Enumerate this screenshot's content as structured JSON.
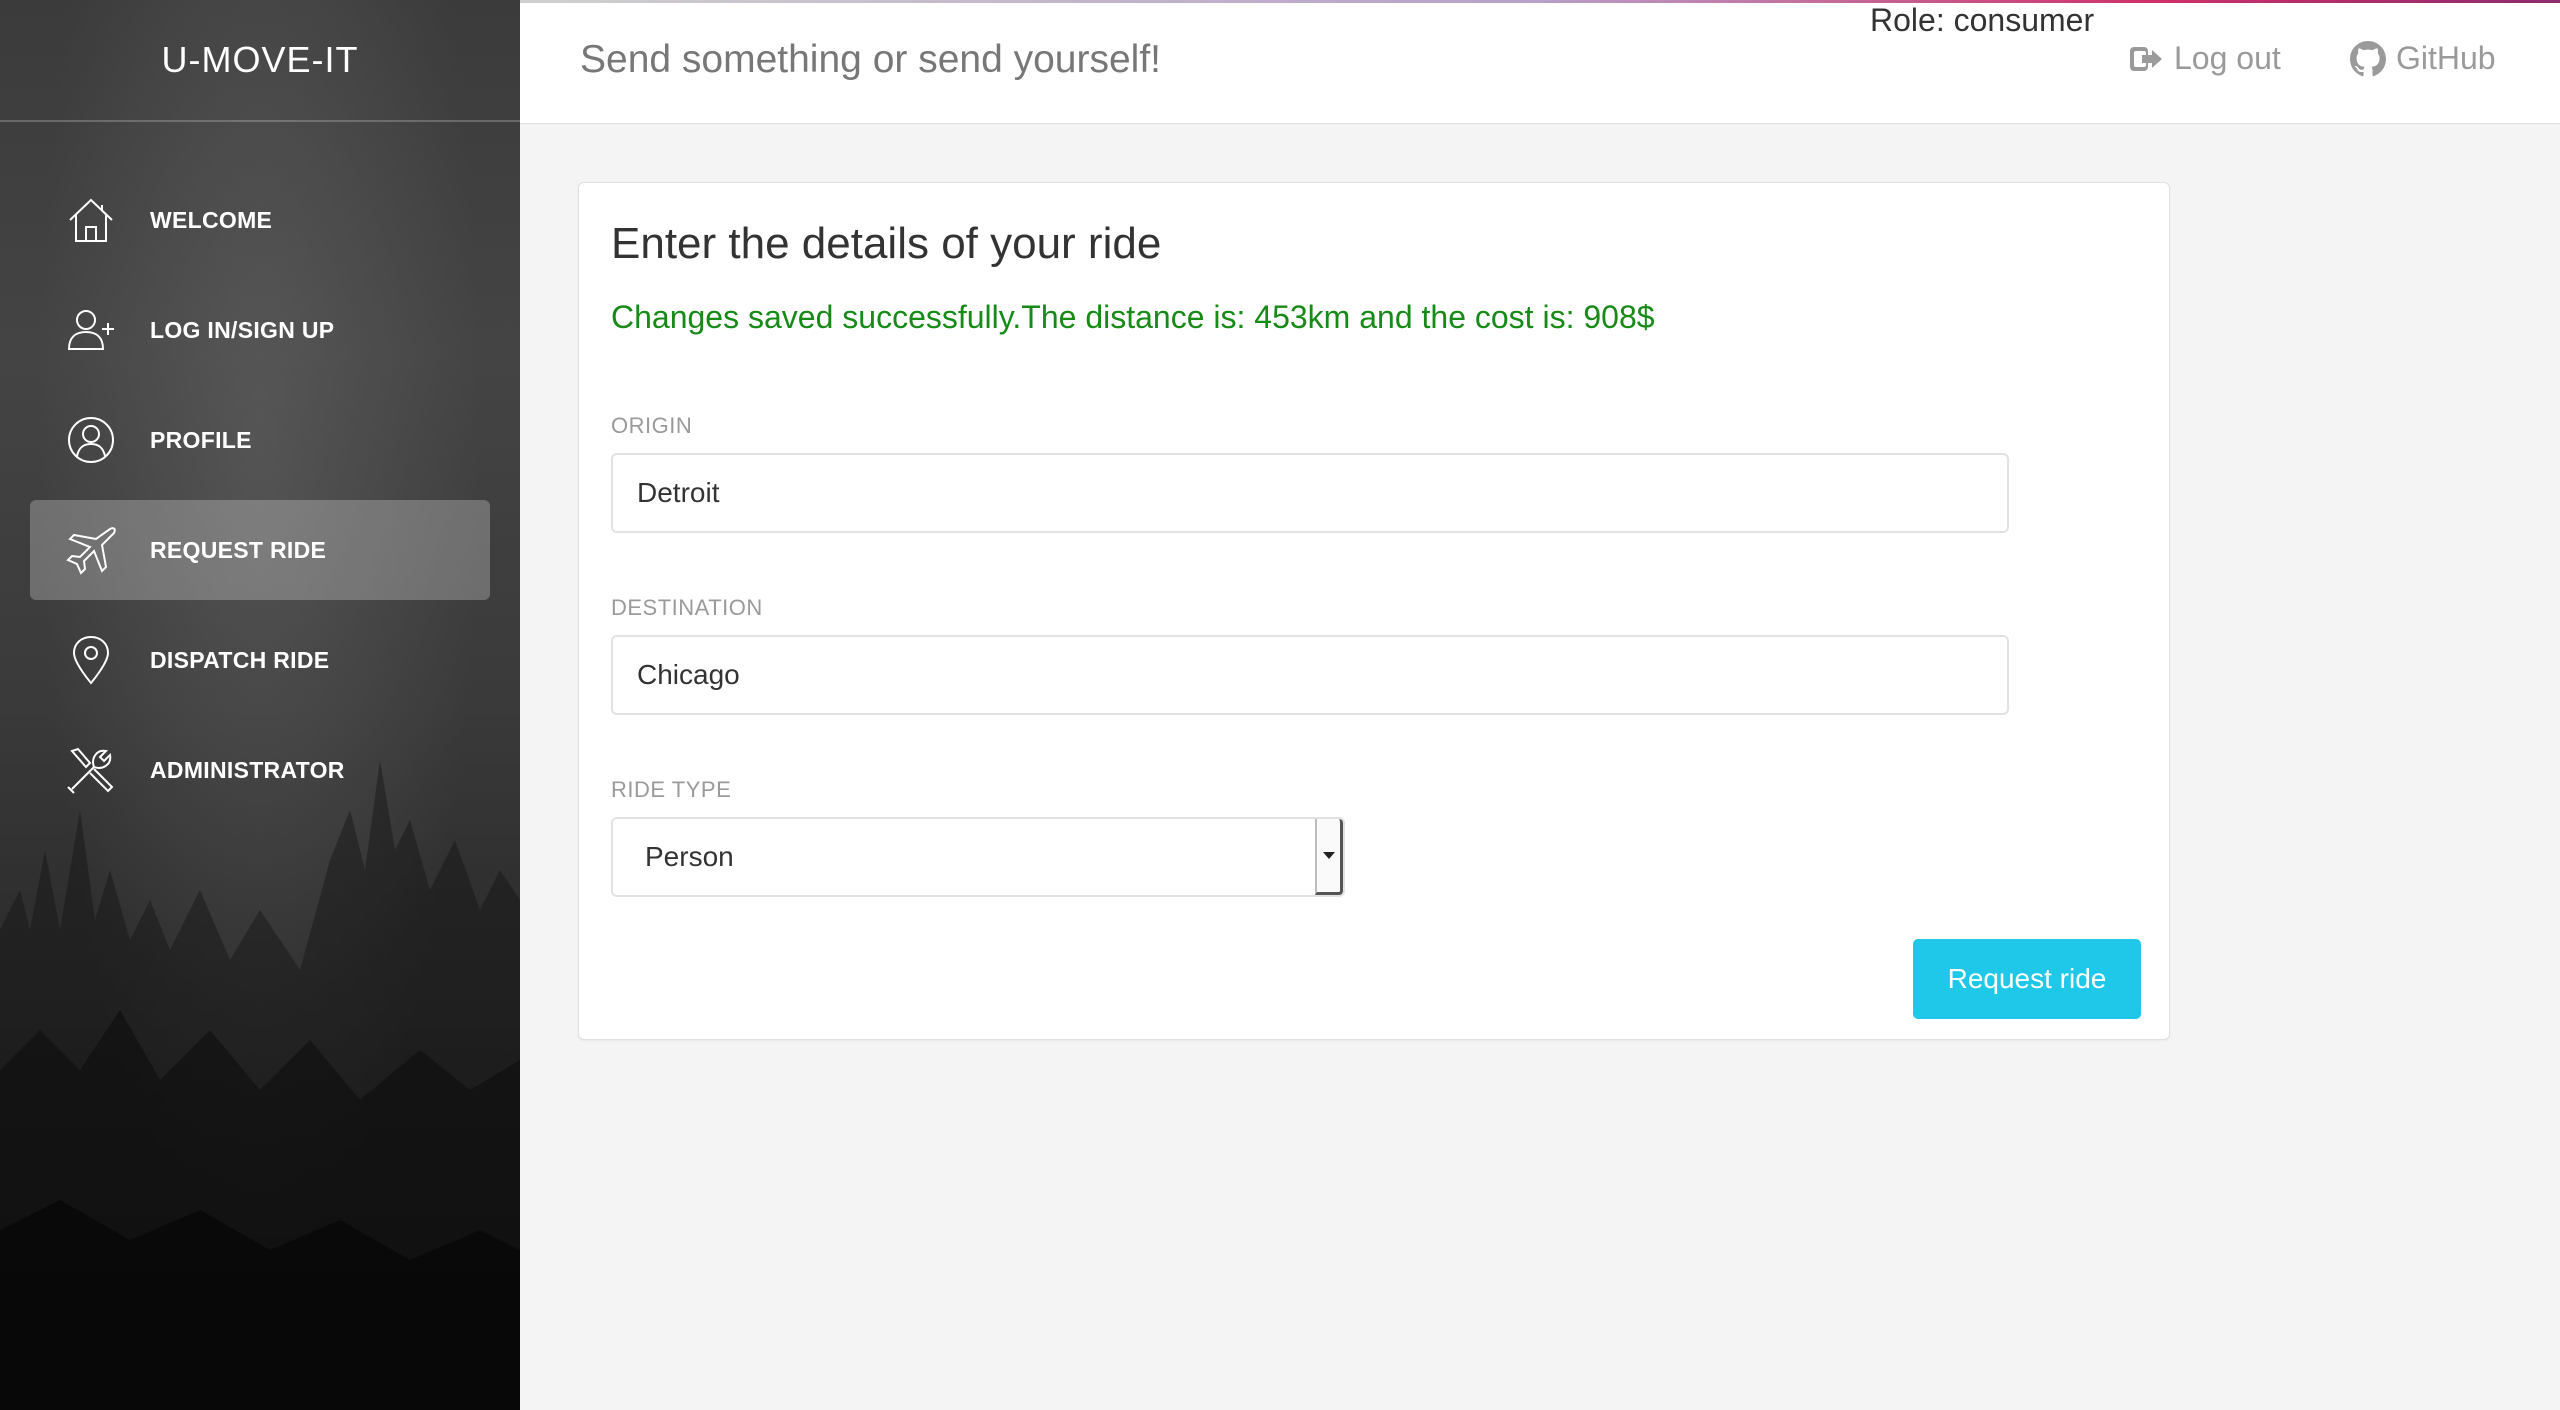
{
  "sidebar": {
    "brand": "U-MOVE-IT",
    "items": [
      {
        "label": "WELCOME",
        "icon": "home-icon",
        "active": false
      },
      {
        "label": "LOG IN/SIGN UP",
        "icon": "add-user-icon",
        "active": false
      },
      {
        "label": "PROFILE",
        "icon": "user-circle-icon",
        "active": false
      },
      {
        "label": "REQUEST RIDE",
        "icon": "airplane-icon",
        "active": true
      },
      {
        "label": "DISPATCH RIDE",
        "icon": "map-pin-icon",
        "active": false
      },
      {
        "label": "ADMINISTRATOR",
        "icon": "tools-icon",
        "active": false
      }
    ]
  },
  "header": {
    "title": "Send something or send yourself!",
    "role": "Role: consumer",
    "logout_label": "Log out",
    "github_label": "GitHub"
  },
  "form": {
    "title": "Enter the details of your ride",
    "success_message": "Changes saved successfully.The distance is: 453km and the cost is: 908$",
    "origin_label": "ORIGIN",
    "origin_value": "Detroit",
    "destination_label": "DESTINATION",
    "destination_value": "Chicago",
    "ride_type_label": "RIDE TYPE",
    "ride_type_value": "Person",
    "submit_label": "Request ride"
  },
  "colors": {
    "success": "#178a17",
    "button": "#1fc8e8",
    "sidebar_dark": "#2b2b2b"
  }
}
